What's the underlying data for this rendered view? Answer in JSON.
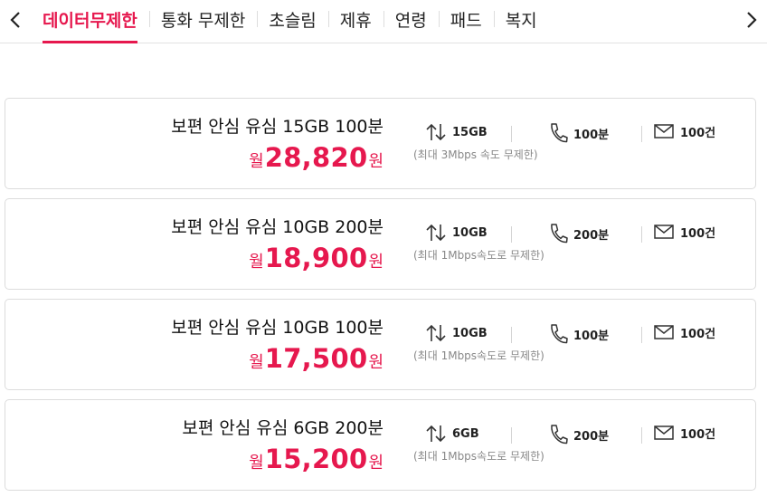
{
  "nav": {
    "prev_icon": "chevron-left-icon",
    "next_icon": "chevron-right-icon"
  },
  "tabs": [
    {
      "label": "데이터무제한",
      "active": true
    },
    {
      "label": "통화 무제한",
      "active": false
    },
    {
      "label": "초슬림",
      "active": false
    },
    {
      "label": "제휴",
      "active": false
    },
    {
      "label": "연령",
      "active": false
    },
    {
      "label": "패드",
      "active": false
    },
    {
      "label": "복지",
      "active": false
    }
  ],
  "colors": {
    "accent": "#e6184e"
  },
  "plans": [
    {
      "name": "보편 안심 유심 15GB 100분",
      "price_prefix": "월",
      "price": "28,820",
      "price_suffix": "원",
      "data": "15GB",
      "data_note": "(최대 3Mbps 속도 무제한)",
      "calls": "100분",
      "sms": "100건"
    },
    {
      "name": "보편 안심 유심 10GB 200분",
      "price_prefix": "월",
      "price": "18,900",
      "price_suffix": "원",
      "data": "10GB",
      "data_note": "(최대 1Mbps속도로 무제한)",
      "calls": "200분",
      "sms": "100건"
    },
    {
      "name": "보편 안심 유심 10GB 100분",
      "price_prefix": "월",
      "price": "17,500",
      "price_suffix": "원",
      "data": "10GB",
      "data_note": "(최대 1Mbps속도로 무제한)",
      "calls": "100분",
      "sms": "100건"
    },
    {
      "name": "보편 안심 유심 6GB 200분",
      "price_prefix": "월",
      "price": "15,200",
      "price_suffix": "원",
      "data": "6GB",
      "data_note": "(최대 1Mbps속도로 무제한)",
      "calls": "200분",
      "sms": "100건"
    }
  ]
}
